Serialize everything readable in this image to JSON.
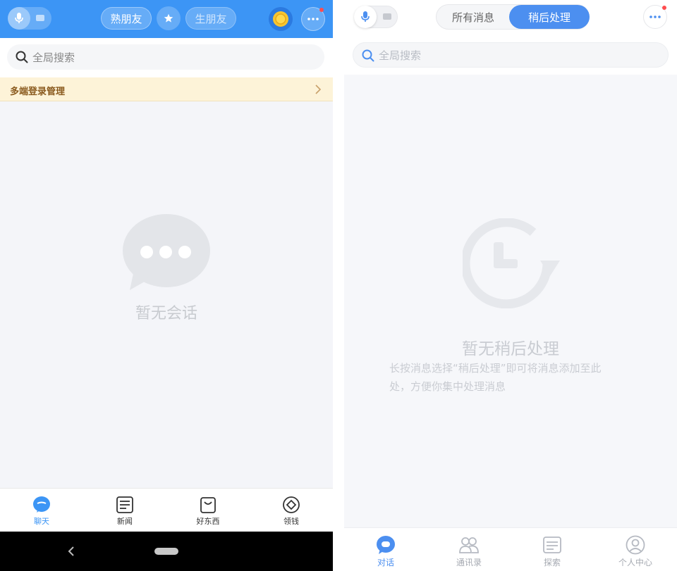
{
  "left": {
    "header": {
      "tab_friends": "熟朋友",
      "tab_strangers": "生朋友"
    },
    "search_placeholder": "全局搜索",
    "banner_label": "多端登录管理",
    "empty_text": "暂无会话",
    "tabbar": [
      {
        "label": "聊天",
        "icon": "chat-icon",
        "active": true
      },
      {
        "label": "新闻",
        "icon": "news-icon",
        "active": false
      },
      {
        "label": "好东西",
        "icon": "shopping-bag-icon",
        "active": false
      },
      {
        "label": "领钱",
        "icon": "coin-diamond-icon",
        "active": false
      }
    ]
  },
  "right": {
    "segment": {
      "all": "所有消息",
      "later": "稍后处理",
      "selected": "later"
    },
    "search_placeholder": "全局搜索",
    "empty_title": "暂无稍后处理",
    "empty_desc_1": "长按消息选择“稍后处理”即可将消息添加至此",
    "empty_desc_2": "处，方便你集中处理消息",
    "tabbar": [
      {
        "label": "对话",
        "icon": "chat-icon",
        "active": true
      },
      {
        "label": "通讯录",
        "icon": "contacts-icon",
        "active": false
      },
      {
        "label": "探索",
        "icon": "explore-icon",
        "active": false
      },
      {
        "label": "个人中心",
        "icon": "profile-icon",
        "active": false
      }
    ]
  },
  "colors": {
    "brand_blue": "#3c95f5",
    "accent_blue": "#4c8ff0",
    "notification_red": "#ff4d4f",
    "banner_bg": "#fdf3d8",
    "banner_text": "#8a5a1e"
  }
}
